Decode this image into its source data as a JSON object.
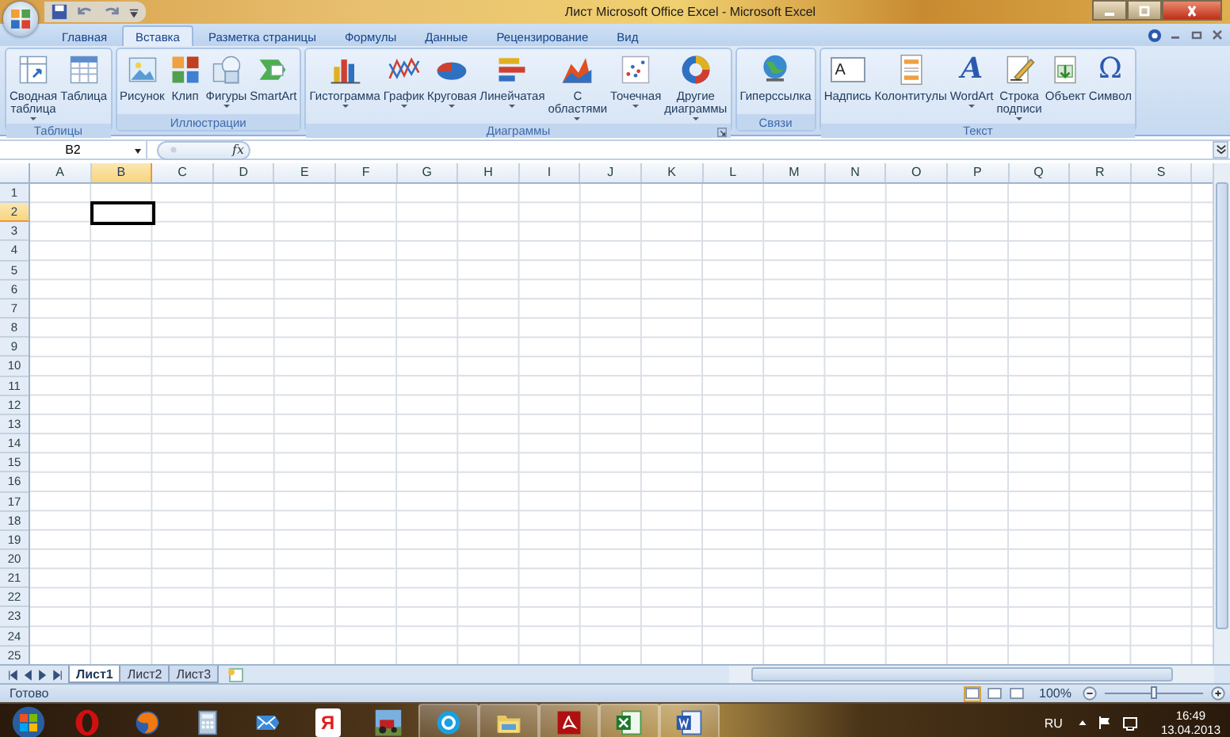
{
  "window": {
    "title": "Лист Microsoft Office Excel - Microsoft Excel"
  },
  "tabs": [
    {
      "label": "Главная",
      "selected": false
    },
    {
      "label": "Вставка",
      "selected": true
    },
    {
      "label": "Разметка страницы",
      "selected": false
    },
    {
      "label": "Формулы",
      "selected": false
    },
    {
      "label": "Данные",
      "selected": false
    },
    {
      "label": "Рецензирование",
      "selected": false
    },
    {
      "label": "Вид",
      "selected": false
    }
  ],
  "ribbon_groups": [
    {
      "label": "Таблицы",
      "launcher": false,
      "buttons": [
        {
          "kind": "icon",
          "label": "Сводная\nтаблица",
          "dropdown": true
        },
        {
          "kind": "icon",
          "label": "Таблица",
          "dropdown": false
        }
      ]
    },
    {
      "label": "Иллюстрации",
      "launcher": false,
      "buttons": [
        {
          "kind": "icon",
          "label": "Рисунок",
          "dropdown": false
        },
        {
          "kind": "icon",
          "label": "Клип",
          "dropdown": false
        },
        {
          "kind": "icon",
          "label": "Фигуры",
          "dropdown": true
        },
        {
          "kind": "icon",
          "label": "SmartArt",
          "dropdown": false
        }
      ]
    },
    {
      "label": "Диаграммы",
      "launcher": true,
      "buttons": [
        {
          "kind": "icon",
          "label": "Гистограмма",
          "dropdown": true
        },
        {
          "kind": "icon",
          "label": "График",
          "dropdown": true
        },
        {
          "kind": "icon",
          "label": "Круговая",
          "dropdown": true
        },
        {
          "kind": "icon",
          "label": "Линейчатая",
          "dropdown": true
        },
        {
          "kind": "icon",
          "label": "С\nобластями",
          "dropdown": true
        },
        {
          "kind": "icon",
          "label": "Точечная",
          "dropdown": true
        },
        {
          "kind": "icon",
          "label": "Другие\nдиаграммы",
          "dropdown": true
        }
      ]
    },
    {
      "label": "Связи",
      "launcher": false,
      "buttons": [
        {
          "kind": "icon",
          "label": "Гиперссылка",
          "dropdown": false
        }
      ]
    },
    {
      "label": "Текст",
      "launcher": false,
      "buttons": [
        {
          "kind": "boxed-glyph",
          "glyph": "A",
          "label": "Надпись",
          "dropdown": false
        },
        {
          "kind": "icon",
          "label": "Колонтитулы",
          "dropdown": false
        },
        {
          "kind": "glyph",
          "glyph": "A",
          "label": "WordArt",
          "dropdown": true
        },
        {
          "kind": "icon",
          "label": "Строка\nподписи",
          "dropdown": true
        },
        {
          "kind": "icon",
          "label": "Объект",
          "dropdown": false
        },
        {
          "kind": "glyph",
          "glyph": "Ω",
          "label": "Символ",
          "dropdown": false
        }
      ]
    }
  ],
  "formula_bar": {
    "name_box": "B2",
    "function_button": "fx"
  },
  "columns": [
    {
      "label": "A",
      "selected": false
    },
    {
      "label": "B",
      "selected": true
    },
    {
      "label": "C",
      "selected": false
    },
    {
      "label": "D",
      "selected": false
    },
    {
      "label": "E",
      "selected": false
    },
    {
      "label": "F",
      "selected": false
    },
    {
      "label": "G",
      "selected": false
    },
    {
      "label": "H",
      "selected": false
    },
    {
      "label": "I",
      "selected": false
    },
    {
      "label": "J",
      "selected": false
    },
    {
      "label": "K",
      "selected": false
    },
    {
      "label": "L",
      "selected": false
    },
    {
      "label": "M",
      "selected": false
    },
    {
      "label": "N",
      "selected": false
    },
    {
      "label": "O",
      "selected": false
    },
    {
      "label": "P",
      "selected": false
    },
    {
      "label": "Q",
      "selected": false
    },
    {
      "label": "R",
      "selected": false
    },
    {
      "label": "S",
      "selected": false
    }
  ],
  "rows": [
    {
      "label": "1",
      "selected": false
    },
    {
      "label": "2",
      "selected": true
    },
    {
      "label": "3",
      "selected": false
    },
    {
      "label": "4",
      "selected": false
    },
    {
      "label": "5",
      "selected": false
    },
    {
      "label": "6",
      "selected": false
    },
    {
      "label": "7",
      "selected": false
    },
    {
      "label": "8",
      "selected": false
    },
    {
      "label": "9",
      "selected": false
    },
    {
      "label": "10",
      "selected": false
    },
    {
      "label": "11",
      "selected": false
    },
    {
      "label": "12",
      "selected": false
    },
    {
      "label": "13",
      "selected": false
    },
    {
      "label": "14",
      "selected": false
    },
    {
      "label": "15",
      "selected": false
    },
    {
      "label": "16",
      "selected": false
    },
    {
      "label": "17",
      "selected": false
    },
    {
      "label": "18",
      "selected": false
    },
    {
      "label": "19",
      "selected": false
    },
    {
      "label": "20",
      "selected": false
    },
    {
      "label": "21",
      "selected": false
    },
    {
      "label": "22",
      "selected": false
    },
    {
      "label": "23",
      "selected": false
    },
    {
      "label": "24",
      "selected": false
    },
    {
      "label": "25",
      "selected": false
    }
  ],
  "sheet_tabs": [
    {
      "label": "Лист1",
      "selected": true
    },
    {
      "label": "Лист2",
      "selected": false
    },
    {
      "label": "Лист3",
      "selected": false
    }
  ],
  "status_bar": {
    "status": "Готово",
    "views": [
      {
        "selected": true
      },
      {
        "selected": false
      },
      {
        "selected": false
      }
    ],
    "zoom": "100%",
    "zoom_slider": {
      "level": 0.5
    }
  },
  "taskbar": {
    "apps": [
      {
        "running": false
      },
      {
        "running": false
      },
      {
        "running": false
      },
      {
        "running": false
      },
      {
        "running": false,
        "glyph": "Я"
      },
      {
        "running": false
      },
      {
        "running": true
      },
      {
        "running": true
      },
      {
        "running": true
      },
      {
        "running": true
      },
      {
        "running": true
      }
    ],
    "tray": {
      "language": "RU",
      "time": "16:49",
      "date": "13.04.2013"
    }
  }
}
